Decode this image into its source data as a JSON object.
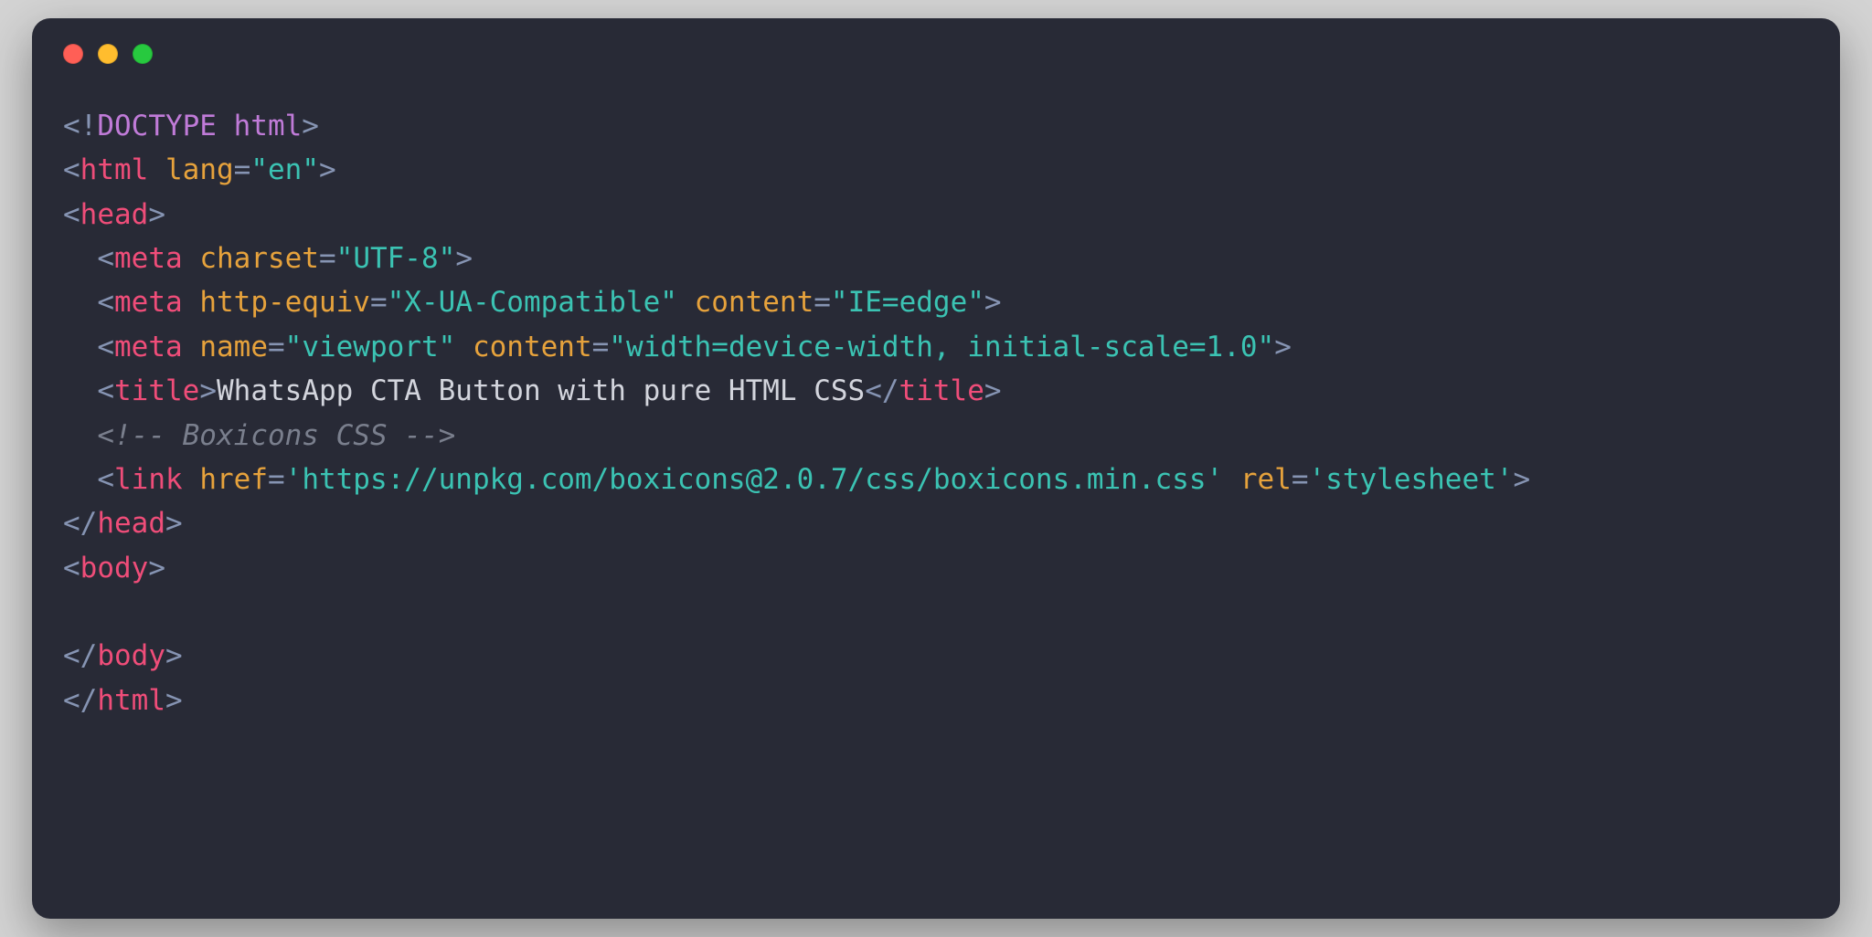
{
  "doctype": {
    "open": "<!",
    "word": "DOCTYPE ",
    "html": "html",
    "close": ">"
  },
  "html_open": {
    "o": "<",
    "tag": "html ",
    "attr": "lang",
    "eq": "=",
    "val": "\"en\"",
    "c": ">"
  },
  "head_open": {
    "o": "<",
    "tag": "head",
    "c": ">"
  },
  "meta1": {
    "o": "<",
    "tag": "meta ",
    "attr1": "charset",
    "eq": "=",
    "val1": "\"UTF-8\"",
    "c": ">"
  },
  "meta2": {
    "o": "<",
    "tag": "meta ",
    "attr1": "http-equiv",
    "eq1": "=",
    "val1": "\"X-UA-Compatible\" ",
    "attr2": "content",
    "eq2": "=",
    "val2": "\"IE=edge\"",
    "c": ">"
  },
  "meta3": {
    "o": "<",
    "tag": "meta ",
    "attr1": "name",
    "eq1": "=",
    "val1": "\"viewport\" ",
    "attr2": "content",
    "eq2": "=",
    "val2": "\"width=device-width, initial-scale=1.0\"",
    "c": ">"
  },
  "title": {
    "o": "<",
    "tag": "title",
    "c": ">",
    "text": "WhatsApp CTA Button with pure HTML CSS",
    "co": "</",
    "ctag": "title",
    "cc": ">"
  },
  "comment": "<!-- Boxicons CSS -->",
  "link": {
    "o": "<",
    "tag": "link ",
    "attr1": "href",
    "eq1": "=",
    "val1": "'https://unpkg.com/boxicons@2.0.7/css/boxicons.min.css' ",
    "attr2": "rel",
    "eq2": "=",
    "val2": "'stylesheet'",
    "c": ">"
  },
  "head_close": {
    "o": "</",
    "tag": "head",
    "c": ">"
  },
  "body_open": {
    "o": "<",
    "tag": "body",
    "c": ">"
  },
  "body_close": {
    "o": "</",
    "tag": "body",
    "c": ">"
  },
  "html_close": {
    "o": "</",
    "tag": "html",
    "c": ">"
  }
}
